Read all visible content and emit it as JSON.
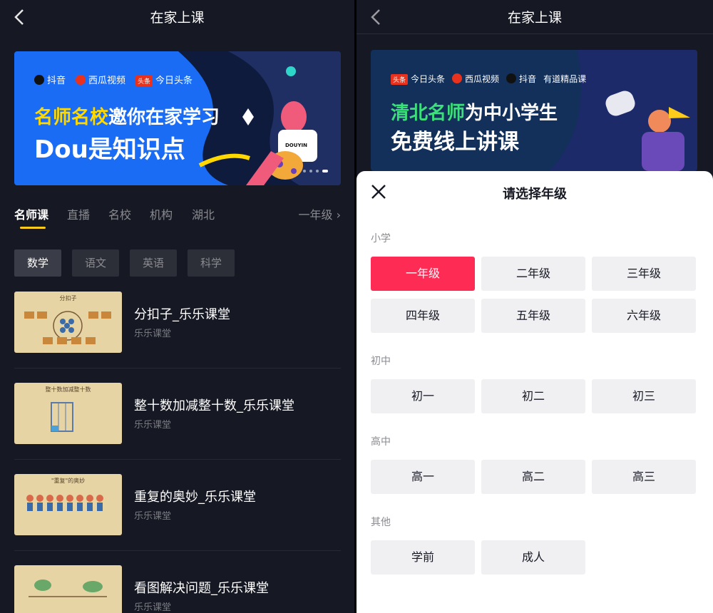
{
  "left": {
    "header": {
      "title": "在家上课"
    },
    "banner": {
      "logos": [
        "抖音",
        "西瓜视频",
        "今日头条"
      ],
      "headline_accent": "名师名校",
      "headline_rest": "邀你在家学习",
      "headline2": "Dou是知识点",
      "badge": "DOUYIN",
      "headline_accent_color": "#ffd800"
    },
    "tabs": [
      "名师课",
      "直播",
      "名校",
      "机构",
      "湖北"
    ],
    "grade_selector": {
      "label": "一年级"
    },
    "subjects": [
      "数学",
      "语文",
      "英语",
      "科学"
    ],
    "courses": [
      {
        "title": "分扣子_乐乐课堂",
        "source": "乐乐课堂",
        "thumb_title": "分扣子"
      },
      {
        "title": "整十数加减整十数_乐乐课堂",
        "source": "乐乐课堂",
        "thumb_title": "整十数加减整十数"
      },
      {
        "title": "重复的奥妙_乐乐课堂",
        "source": "乐乐课堂",
        "thumb_title": "\"重复\"的奥妙"
      },
      {
        "title": "看图解决问题_乐乐课堂",
        "source": "乐乐课堂",
        "thumb_title": ""
      }
    ]
  },
  "right": {
    "header": {
      "title": "在家上课"
    },
    "banner": {
      "logos": [
        "今日头条",
        "西瓜视频",
        "抖音",
        "有道精品课"
      ],
      "headline_accent": "清北名师",
      "headline_rest": "为中小学生",
      "headline2": "免费线上讲课",
      "headline_accent_color": "#3ce07a"
    },
    "sheet": {
      "title": "请选择年级",
      "sections": [
        {
          "label": "小学",
          "grades": [
            "一年级",
            "二年级",
            "三年级",
            "四年级",
            "五年级",
            "六年级"
          ]
        },
        {
          "label": "初中",
          "grades": [
            "初一",
            "初二",
            "初三"
          ]
        },
        {
          "label": "高中",
          "grades": [
            "高一",
            "高二",
            "高三"
          ]
        },
        {
          "label": "其他",
          "grades": [
            "学前",
            "成人"
          ]
        }
      ],
      "selected": "一年级",
      "selected_color": "#fe2c55"
    }
  }
}
